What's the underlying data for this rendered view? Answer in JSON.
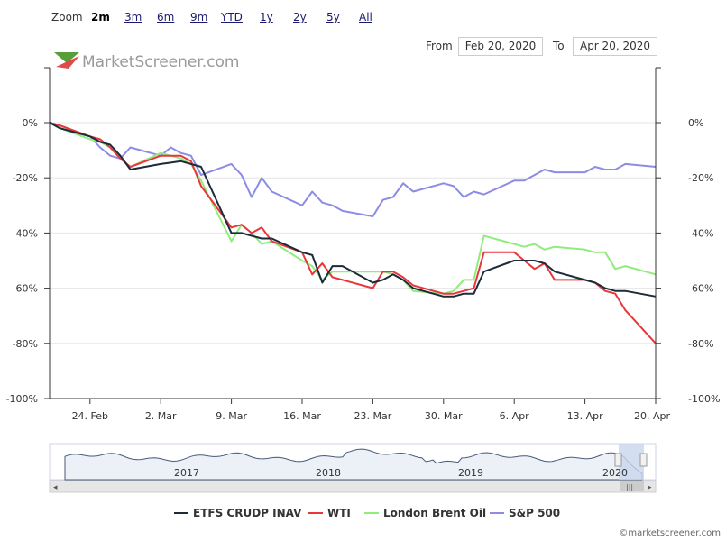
{
  "zoom": {
    "label": "Zoom",
    "buttons": [
      "2m",
      "3m",
      "6m",
      "9m",
      "YTD",
      "1y",
      "2y",
      "5y",
      "All"
    ],
    "active": "2m"
  },
  "range": {
    "from_label": "From",
    "from_value": "Feb 20, 2020",
    "to_label": "To",
    "to_value": "Apr 20, 2020"
  },
  "watermark": {
    "text": "MarketScreener.com",
    "logo_colors": [
      "#5a9e3c",
      "#e04a4a"
    ]
  },
  "credit": "©marketscreener.com",
  "colors": {
    "ETFS CRUDP INAV": "#1c2b3a",
    "WTI": "#e8373b",
    "London Brent Oil": "#90ed7d",
    "S&P 500": "#8c8ce6",
    "grid": "#e6e6e6",
    "navigator_fill": "#c9d6ee"
  },
  "navigator": {
    "years": [
      "2017",
      "2018",
      "2019",
      "2020"
    ]
  },
  "chart_data": {
    "type": "line",
    "y_tick_labels": [
      "0%",
      "-20%",
      "-40%",
      "-60%",
      "-80%",
      "-100%"
    ],
    "ylim": [
      -100,
      0
    ],
    "x_tick_labels": [
      "24. Feb",
      "2. Mar",
      "9. Mar",
      "16. Mar",
      "23. Mar",
      "30. Mar",
      "6. Apr",
      "13. Apr",
      "20. Apr"
    ],
    "x_tick_days": [
      4,
      11,
      18,
      25,
      32,
      39,
      46,
      53,
      60
    ],
    "xlim": [
      "2020-02-20",
      "2020-04-20"
    ],
    "legend": [
      "ETFS CRUDP INAV",
      "WTI",
      "London Brent Oil",
      "S&P 500"
    ],
    "legend_position": "bottom",
    "series": [
      {
        "name": "ETFS CRUDP INAV",
        "x": [
          0,
          1,
          4,
          5,
          6,
          7,
          8,
          11,
          12,
          13,
          14,
          15,
          18,
          19,
          20,
          21,
          22,
          25,
          26,
          27,
          28,
          29,
          32,
          33,
          34,
          35,
          36,
          39,
          40,
          41,
          42,
          43,
          46,
          47,
          48,
          49,
          50,
          53,
          54,
          55,
          56,
          57,
          60
        ],
        "y": [
          0,
          -2,
          -5,
          -7,
          -8,
          -12,
          -17,
          -15,
          -14.5,
          -14,
          -15,
          -16,
          -40,
          -40,
          -41,
          -42,
          -42,
          -47,
          -48,
          -58,
          -52,
          -52,
          -58,
          -57,
          -55,
          -57,
          -60,
          -63,
          -63,
          -62,
          -62,
          -54,
          -50,
          -50,
          -50,
          -51,
          -54,
          -57,
          -58,
          -60,
          -61,
          -61,
          -63
        ]
      },
      {
        "name": "WTI",
        "x": [
          0,
          1,
          4,
          5,
          6,
          7,
          8,
          11,
          12,
          13,
          14,
          15,
          18,
          19,
          20,
          21,
          22,
          25,
          26,
          27,
          28,
          29,
          32,
          33,
          34,
          35,
          36,
          39,
          40,
          41,
          42,
          43,
          46,
          47,
          48,
          49,
          50,
          53,
          54,
          55,
          56,
          57,
          60
        ],
        "y": [
          0,
          -1,
          -5,
          -6,
          -9,
          -13,
          -16,
          -12,
          -12,
          -12,
          -14,
          -23,
          -38,
          -37,
          -40,
          -38,
          -43,
          -47,
          -55,
          -51,
          -56,
          -57,
          -60,
          -54,
          -54,
          -56,
          -59,
          -62,
          -62,
          -61,
          -60,
          -47,
          -47,
          -50,
          -53,
          -51,
          -57,
          -57,
          -58,
          -61,
          -62,
          -68,
          -80
        ]
      },
      {
        "name": "London Brent Oil",
        "x": [
          0,
          1,
          4,
          5,
          6,
          7,
          8,
          11,
          12,
          13,
          14,
          15,
          18,
          19,
          20,
          21,
          22,
          25,
          26,
          27,
          28,
          29,
          32,
          33,
          34,
          35,
          36,
          39,
          40,
          41,
          42,
          43,
          46,
          47,
          48,
          49,
          50,
          53,
          54,
          55,
          56,
          57,
          60
        ],
        "y": [
          0,
          -2,
          -6,
          -7,
          -9,
          -13,
          -16,
          -11,
          -12,
          -13,
          -15,
          -21,
          -43,
          -37,
          -40,
          -44,
          -43,
          -50,
          -52,
          -57,
          -54,
          -54,
          -54,
          -54,
          -55,
          -57,
          -61,
          -62,
          -61,
          -57,
          -57,
          -41,
          -44,
          -45,
          -44,
          -46,
          -45,
          -46,
          -47,
          -47,
          -53,
          -52,
          -55
        ]
      },
      {
        "name": "S&P 500",
        "x": [
          0,
          1,
          4,
          5,
          6,
          7,
          8,
          11,
          12,
          13,
          14,
          15,
          18,
          19,
          20,
          21,
          22,
          25,
          26,
          27,
          28,
          29,
          32,
          33,
          34,
          35,
          36,
          39,
          40,
          41,
          42,
          43,
          46,
          47,
          48,
          49,
          50,
          53,
          54,
          55,
          56,
          57,
          60
        ],
        "y": [
          0,
          -1,
          -5,
          -9,
          -12,
          -13,
          -9,
          -12,
          -9,
          -11,
          -12,
          -19,
          -15,
          -19,
          -27,
          -20,
          -25,
          -30,
          -25,
          -29,
          -30,
          -32,
          -34,
          -28,
          -27,
          -22,
          -25,
          -22,
          -23,
          -27,
          -25,
          -26,
          -21,
          -21,
          -19,
          -17,
          -18,
          -18,
          -16,
          -17,
          -17,
          -15,
          -16
        ]
      }
    ]
  }
}
